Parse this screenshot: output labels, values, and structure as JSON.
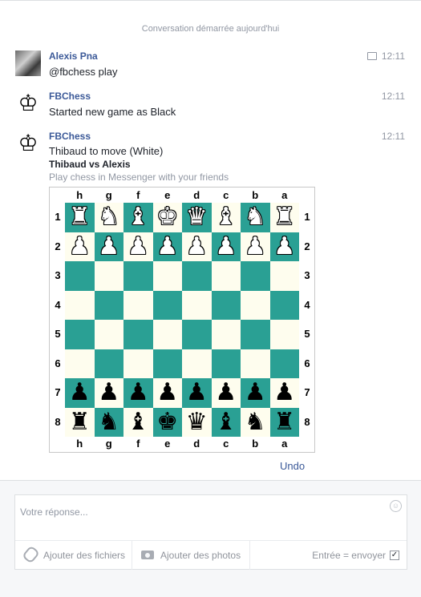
{
  "header": {
    "conversation_started": "Conversation démarrée aujourd'hui"
  },
  "messages": [
    {
      "sender": "Alexis Pna",
      "time": "12:11",
      "lines": [
        "@fbchess play"
      ]
    },
    {
      "sender": "FBChess",
      "time": "12:11",
      "lines": [
        "Started new game as Black"
      ]
    },
    {
      "sender": "FBChess",
      "time": "12:11",
      "lines": [
        "Thibaud to move (White)",
        "Thibaud vs Alexis",
        "Play chess in Messenger with your friends"
      ]
    }
  ],
  "board": {
    "files": [
      "h",
      "g",
      "f",
      "e",
      "d",
      "c",
      "b",
      "a"
    ],
    "ranks": [
      "1",
      "2",
      "3",
      "4",
      "5",
      "6",
      "7",
      "8"
    ],
    "rows": [
      [
        "♜",
        "♞",
        "♝",
        "♚",
        "♛",
        "♝",
        "♞",
        "♜"
      ],
      [
        "♟",
        "♟",
        "♟",
        "♟",
        "♟",
        "♟",
        "♟",
        "♟"
      ],
      [
        "",
        "",
        "",
        "",
        "",
        "",
        "",
        ""
      ],
      [
        "",
        "",
        "",
        "",
        "",
        "",
        "",
        ""
      ],
      [
        "",
        "",
        "",
        "",
        "",
        "",
        "",
        ""
      ],
      [
        "",
        "",
        "",
        "",
        "",
        "",
        "",
        ""
      ],
      [
        "♟",
        "♟",
        "♟",
        "♟",
        "♟",
        "♟",
        "♟",
        "♟"
      ],
      [
        "♜",
        "♞",
        "♝",
        "♚",
        "♛",
        "♝",
        "♞",
        "♜"
      ]
    ],
    "row_colors": [
      "white",
      "white",
      "",
      "",
      "",
      "",
      "black",
      "black"
    ],
    "light_color": "#fefdee",
    "dark_color": "#2aa094"
  },
  "actions": {
    "undo": "Undo"
  },
  "composer": {
    "placeholder": "Votre réponse...",
    "attach_files": "Ajouter des fichiers",
    "attach_photos": "Ajouter des photos",
    "enter_to_send": "Entrée = envoyer",
    "enter_to_send_checked": true
  },
  "icons": [
    "seen-icon",
    "king-avatar-icon",
    "smiley-icon",
    "paperclip-icon",
    "camera-icon",
    "checkbox-icon"
  ]
}
